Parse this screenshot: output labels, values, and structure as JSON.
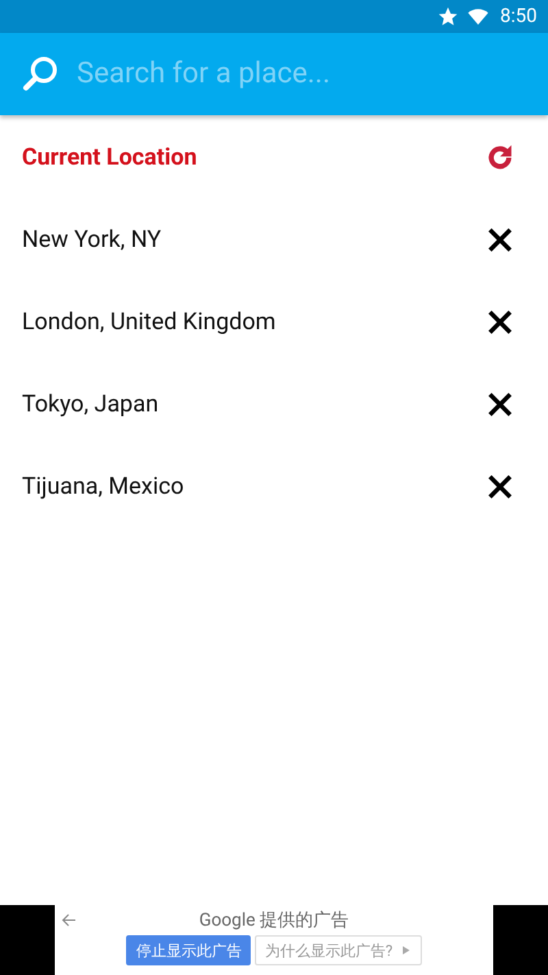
{
  "status_bar": {
    "time": "8:50"
  },
  "search": {
    "placeholder": "Search for a place..."
  },
  "locations": [
    {
      "label": "Current Location",
      "kind": "current"
    },
    {
      "label": "New York, NY",
      "kind": "saved"
    },
    {
      "label": "London, United Kingdom",
      "kind": "saved"
    },
    {
      "label": "Tokyo, Japan",
      "kind": "saved"
    },
    {
      "label": "Tijuana, Mexico",
      "kind": "saved"
    }
  ],
  "ad_banner": {
    "title": "Google 提供的广告",
    "buttons": [
      {
        "label": "停止显示此广告",
        "kind": "primary"
      },
      {
        "label": "为什么显示此广告?",
        "kind": "secondary"
      }
    ]
  }
}
